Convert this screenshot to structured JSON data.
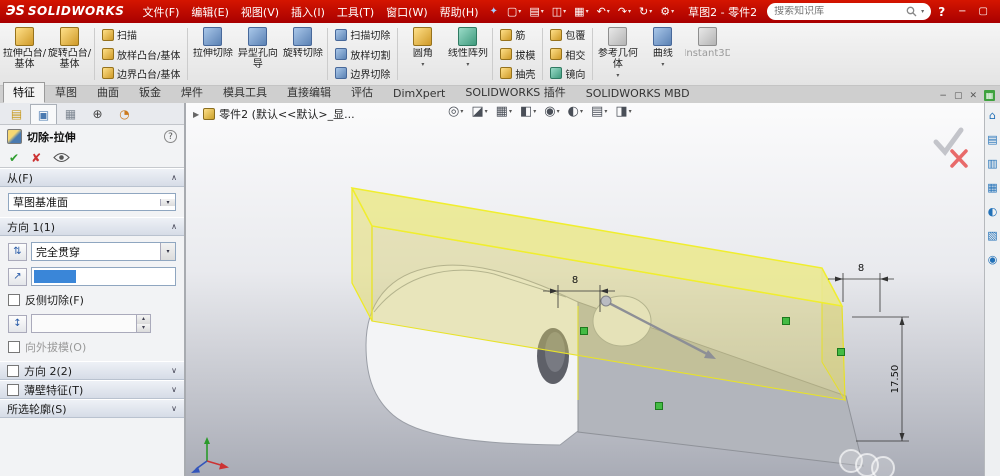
{
  "colors": {
    "titlebar_red": "#c40000",
    "selection_blue": "#3a86d8",
    "preview_yellow": "#ece98c",
    "handle_green": "#44bb44",
    "taskpane_icon_blue": "#2271b8"
  },
  "title_bar": {
    "logo_mark": "ЭS",
    "logo_name": "SOLIDWORKS",
    "menus": [
      "文件(F)",
      "编辑(E)",
      "视图(V)",
      "插入(I)",
      "工具(T)",
      "窗口(W)",
      "帮助(H)"
    ],
    "quick_icons": [
      "new-doc",
      "open-doc",
      "save",
      "print",
      "undo",
      "redo",
      "rebuild",
      "settings"
    ],
    "doc_title": "草图2 - 零件2",
    "search_placeholder": "搜索知识库",
    "help_label": "?",
    "window_buttons": [
      "−",
      "▢"
    ]
  },
  "ribbon": {
    "groups": [
      {
        "type": "big",
        "items": [
          {
            "label": "拉伸凸台/基体",
            "icon": "boss-extrude"
          },
          {
            "label": "旋转凸台/基体",
            "icon": "boss-revolve"
          }
        ]
      },
      {
        "type": "small",
        "items": [
          {
            "label": "扫描",
            "icon": "swept-boss"
          },
          {
            "label": "放样凸台/基体",
            "icon": "lofted-boss"
          },
          {
            "label": "边界凸台/基体",
            "icon": "boundary-boss"
          }
        ]
      },
      {
        "type": "big",
        "items": [
          {
            "label": "拉伸切除",
            "icon": "cut-extrude"
          },
          {
            "label": "异型孔向导",
            "icon": "hole-wizard"
          },
          {
            "label": "旋转切除",
            "icon": "cut-revolve"
          }
        ]
      },
      {
        "type": "small",
        "items": [
          {
            "label": "扫描切除",
            "icon": "swept-cut"
          },
          {
            "label": "放样切割",
            "icon": "lofted-cut"
          },
          {
            "label": "边界切除",
            "icon": "boundary-cut"
          }
        ]
      },
      {
        "type": "big",
        "items": [
          {
            "label": "圆角",
            "icon": "fillet",
            "arrow": true
          },
          {
            "label": "线性阵列",
            "icon": "linear-pattern",
            "arrow": true
          }
        ]
      },
      {
        "type": "small",
        "items": [
          {
            "label": "筋",
            "icon": "rib"
          },
          {
            "label": "拔模",
            "icon": "draft"
          },
          {
            "label": "抽壳",
            "icon": "shell"
          }
        ]
      },
      {
        "type": "small",
        "items": [
          {
            "label": "包覆",
            "icon": "wrap"
          },
          {
            "label": "相交",
            "icon": "intersect"
          },
          {
            "label": "镜向",
            "icon": "mirror"
          }
        ]
      },
      {
        "type": "big",
        "items": [
          {
            "label": "参考几何体",
            "icon": "reference-geometry",
            "arrow": true
          },
          {
            "label": "曲线",
            "icon": "curves",
            "arrow": true
          },
          {
            "label": "Instant3D",
            "icon": "instant3d",
            "disabled": true
          }
        ]
      }
    ],
    "tabs": [
      "特征",
      "草图",
      "曲面",
      "钣金",
      "焊件",
      "模具工具",
      "直接编辑",
      "评估",
      "DimXpert",
      "SOLIDWORKS 插件",
      "SOLIDWORKS MBD"
    ],
    "active_tab_index": 0,
    "doc_window_buttons": [
      "−",
      "▢",
      "✕"
    ]
  },
  "property_manager": {
    "tabs": [
      "feature-manager-tab",
      "property-manager-tab",
      "configuration-manager-tab",
      "dimxpert-manager-tab",
      "display-manager-tab"
    ],
    "active_tab_index": 1,
    "title": "切除-拉伸",
    "help_label": "?",
    "ok_glyph": "✔",
    "cancel_glyph": "✘",
    "sections": {
      "from": {
        "label": "从(F)",
        "plane_value": "草图基准面",
        "expanded": true
      },
      "direction1": {
        "label": "方向 1(1)",
        "end_condition": "完全贯穿",
        "depth_value": "",
        "flip_side_label": "反侧切除(F)",
        "flip_side_checked": false,
        "draft_outward_label": "向外拔模(O)",
        "draft_outward_checked": false,
        "expanded": true
      },
      "direction2": {
        "label": "方向 2(2)",
        "checked": false,
        "expanded": false
      },
      "thin_feature": {
        "label": "薄壁特征(T)",
        "checked": false,
        "expanded": false
      },
      "selected_contours": {
        "label": "所选轮廓(S)",
        "expanded": false
      }
    }
  },
  "viewport": {
    "tree_item_label": "零件2 (默认<<默认>_显...",
    "hud_icons": [
      "zoom-fit",
      "section-view",
      "view-orientation",
      "display-style",
      "hide-show-items",
      "edit-appearance",
      "apply-scene",
      "view-settings"
    ],
    "dimensions": {
      "sketch_width_left": "8",
      "sketch_width_right": "8",
      "cut_height": "17.50"
    }
  },
  "task_pane": {
    "icons": [
      "home",
      "design-library",
      "file-explorer",
      "view-palette",
      "appearances",
      "custom-properties",
      "solidworks-forum"
    ]
  }
}
